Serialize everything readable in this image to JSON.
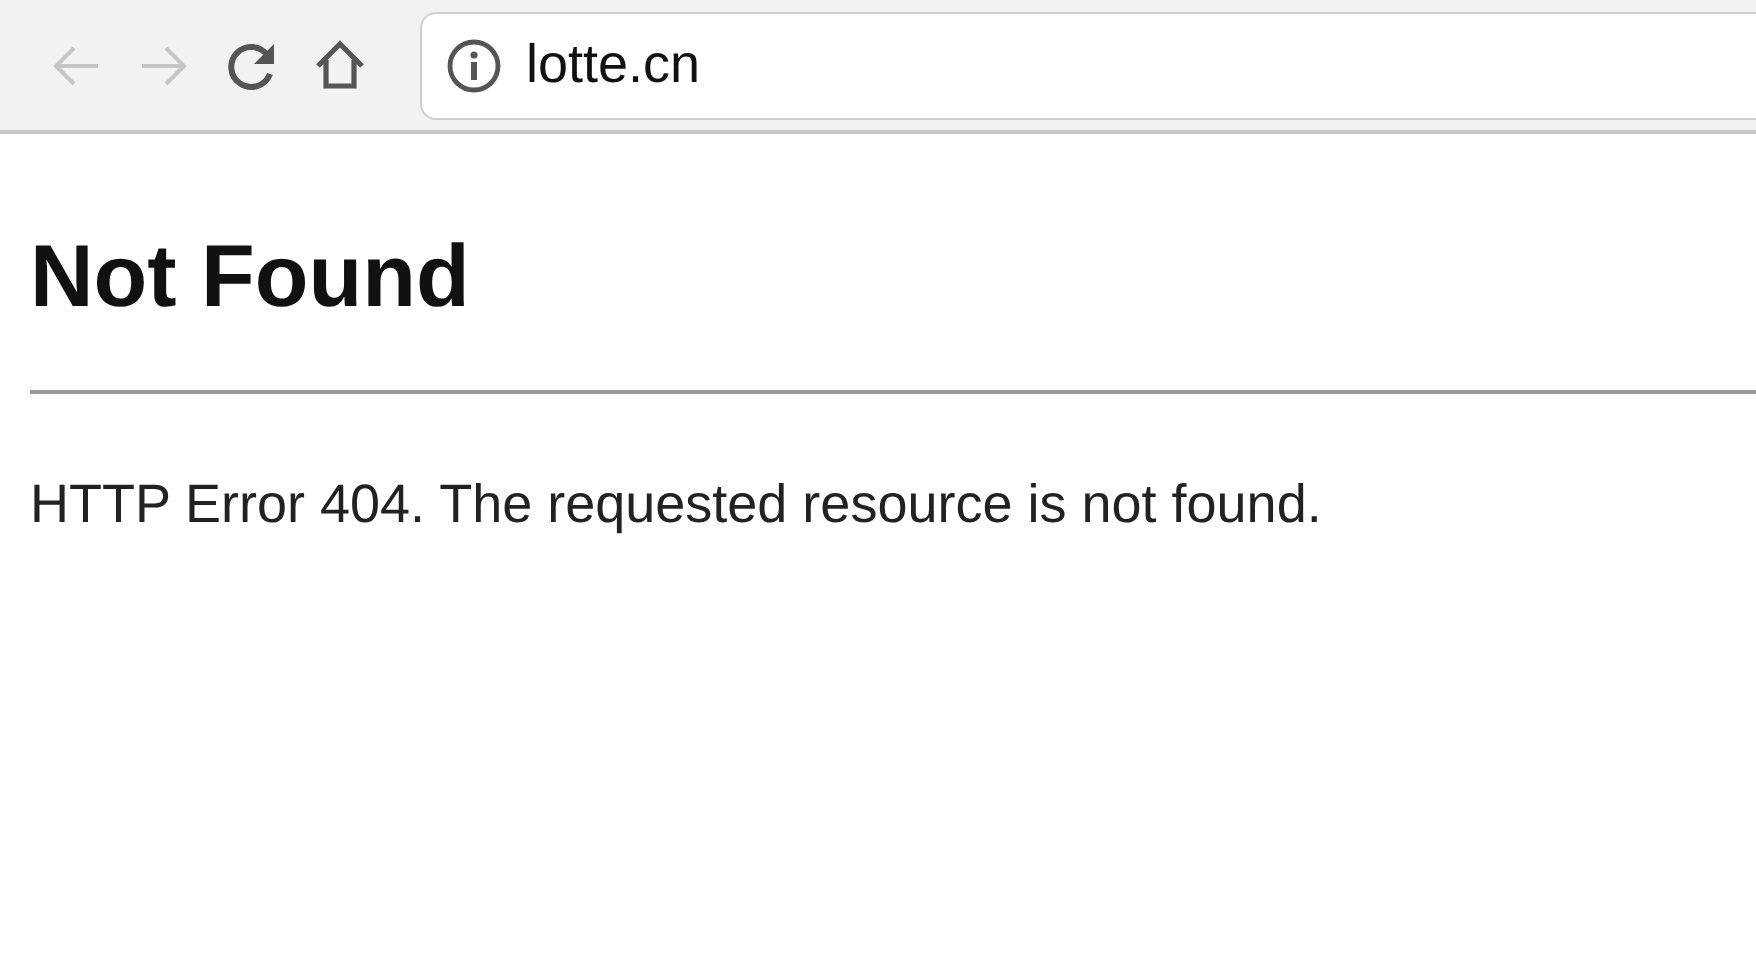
{
  "toolbar": {
    "back": {
      "disabled": true
    },
    "forward": {
      "disabled": true
    },
    "address": "lotte.cn"
  },
  "page": {
    "heading": "Not Found",
    "message": "HTTP Error 404. The requested resource is not found."
  }
}
